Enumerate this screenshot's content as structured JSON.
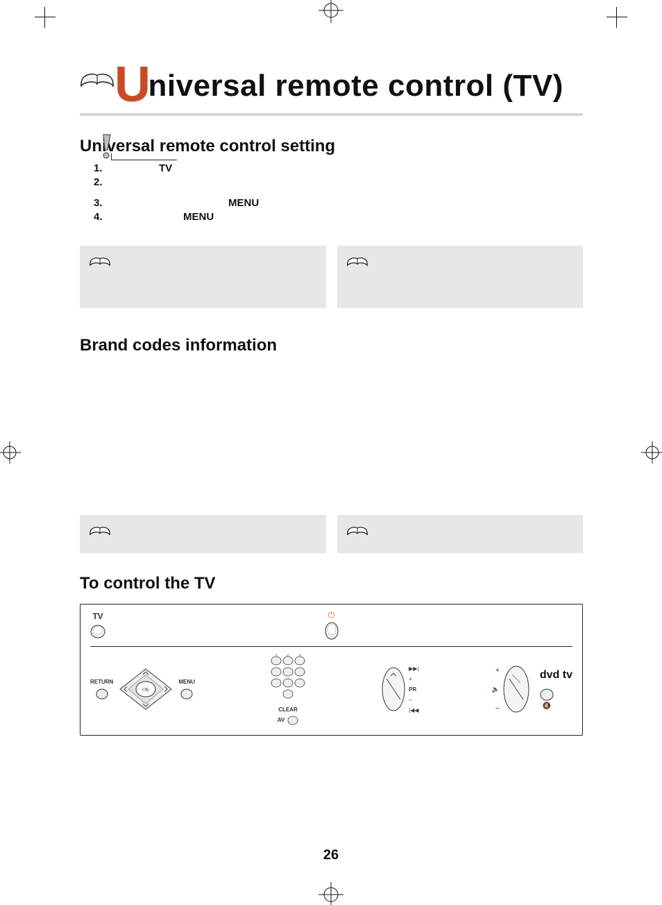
{
  "title": {
    "big_letter": "U",
    "rest": "niversal remote control (TV)"
  },
  "sections": {
    "setting_h": "Universal remote control setting",
    "brand_h": "Brand codes information",
    "control_h": "To control the TV"
  },
  "steps": [
    {
      "num": "1.",
      "bold": "TV"
    },
    {
      "num": "2.",
      "bold": ""
    },
    {
      "num": "3.",
      "bold": "MENU"
    },
    {
      "num": "4.",
      "bold": "MENU"
    }
  ],
  "power_symbol": "⏻",
  "remote": {
    "tv_label": "TV",
    "return_label": "RETURN",
    "menu_label": "MENU",
    "ok_label": "OK",
    "clear_label": "CLEAR",
    "av_label": "AV",
    "pr_label": "PR",
    "plus": "+",
    "minus": "–",
    "mode_label": "dvd  tv"
  },
  "page_number": "26"
}
